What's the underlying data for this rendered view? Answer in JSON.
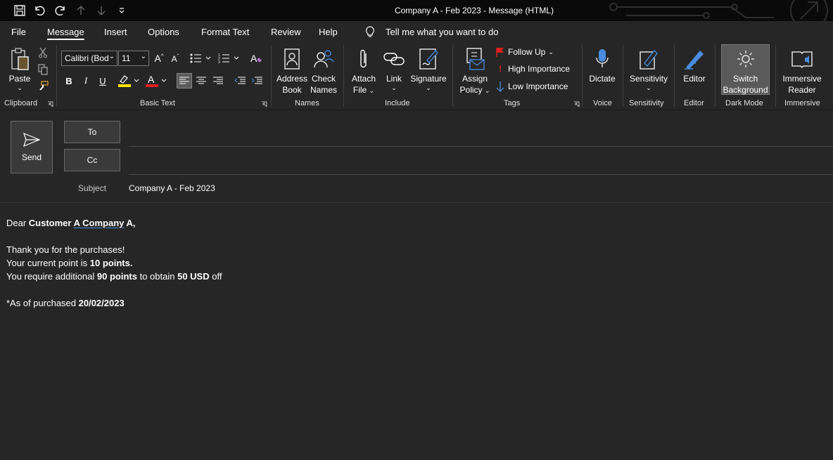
{
  "window": {
    "title": "Company A - Feb 2023  -  Message (HTML)"
  },
  "tabs": [
    "File",
    "Message",
    "Insert",
    "Options",
    "Format Text",
    "Review",
    "Help"
  ],
  "tell_me": "Tell me what you want to do",
  "ribbon": {
    "clipboard": {
      "paste": "Paste",
      "group": "Clipboard"
    },
    "basic_text": {
      "font": "Calibri (Bod",
      "size": "11",
      "group": "Basic Text",
      "bold": "B",
      "italic": "I",
      "underline": "U"
    },
    "names": {
      "address_book_1": "Address",
      "address_book_2": "Book",
      "check_names_1": "Check",
      "check_names_2": "Names",
      "group": "Names"
    },
    "include": {
      "attach_1": "Attach",
      "attach_2": "File",
      "link": "Link",
      "signature": "Signature",
      "group": "Include"
    },
    "tags": {
      "assign_1": "Assign",
      "assign_2": "Policy",
      "follow_up": "Follow Up",
      "high": "High Importance",
      "low": "Low Importance",
      "group": "Tags"
    },
    "voice": {
      "dictate": "Dictate",
      "group": "Voice"
    },
    "sensitivity": {
      "label": "Sensitivity",
      "group": "Sensitivity"
    },
    "editor": {
      "label": "Editor",
      "group": "Editor"
    },
    "dark_mode": {
      "label_1": "Switch",
      "label_2": "Background",
      "group": "Dark Mode"
    },
    "immersive": {
      "label_1": "Immersive",
      "label_2": "Reader",
      "group": "Immersive"
    }
  },
  "compose": {
    "send": "Send",
    "to": "To",
    "cc": "Cc",
    "subject_label": "Subject",
    "subject": "Company A - Feb 2023"
  },
  "body": {
    "dear": "Dear ",
    "cust": "Customer ",
    "a1": "A",
    "sp": " ",
    "company": "Company",
    "a2": " A,",
    "thanks": "Thank you for the purchases!",
    "point_pre": "Your current point is ",
    "point_val": "10 points.",
    "req_pre": "You require additional ",
    "req_pts": "90 points",
    "req_mid": " to obtain ",
    "req_usd": "50 USD",
    "req_post": " off",
    "asof_pre": "*As of purchased ",
    "asof_date": "20/02/2023"
  },
  "colors": {
    "highlight": "#ffe600",
    "font_color": "#e02020",
    "flag": "#e02020",
    "accent_blue": "#4a8de0"
  }
}
